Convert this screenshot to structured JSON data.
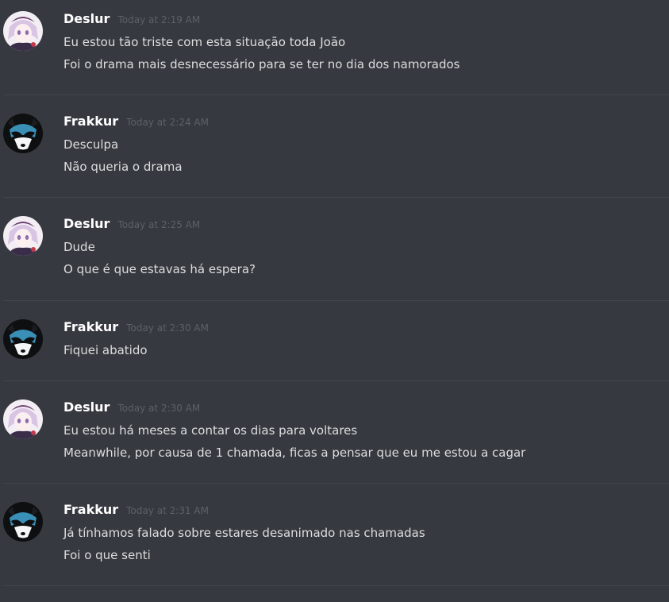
{
  "messages": [
    {
      "author": "Deslur",
      "avatar_icon": "anime-girl-avatar-icon",
      "timestamp": "Today at 2:19 AM",
      "lines": [
        "Eu estou tão triste com esta situação toda João",
        "Foi o drama mais desnecessário para se ter no dia dos namorados"
      ]
    },
    {
      "author": "Frakkur",
      "avatar_icon": "raccoon-avatar-icon",
      "timestamp": "Today at 2:24 AM",
      "lines": [
        "Desculpa",
        "Não queria o drama"
      ]
    },
    {
      "author": "Deslur",
      "avatar_icon": "anime-girl-avatar-icon",
      "timestamp": "Today at 2:25 AM",
      "lines": [
        "Dude",
        "O que é que estavas há espera?"
      ]
    },
    {
      "author": "Frakkur",
      "avatar_icon": "raccoon-avatar-icon",
      "timestamp": "Today at 2:30 AM",
      "lines": [
        "Fiquei abatido"
      ]
    },
    {
      "author": "Deslur",
      "avatar_icon": "anime-girl-avatar-icon",
      "timestamp": "Today at 2:30 AM",
      "lines": [
        "Eu estou há meses a contar os dias para voltares",
        "Meanwhile, por causa de 1 chamada, ficas a pensar que eu me estou a cagar"
      ]
    },
    {
      "author": "Frakkur",
      "avatar_icon": "raccoon-avatar-icon",
      "timestamp": "Today at 2:31 AM",
      "lines": [
        "Já tínhamos falado sobre estares desanimado nas chamadas",
        "Foi o que senti"
      ]
    }
  ],
  "colors": {
    "background": "#36393f",
    "username": "#ffffff",
    "timestamp": "#5d6067",
    "message_text": "#dcddde",
    "divider": "#42454a"
  }
}
